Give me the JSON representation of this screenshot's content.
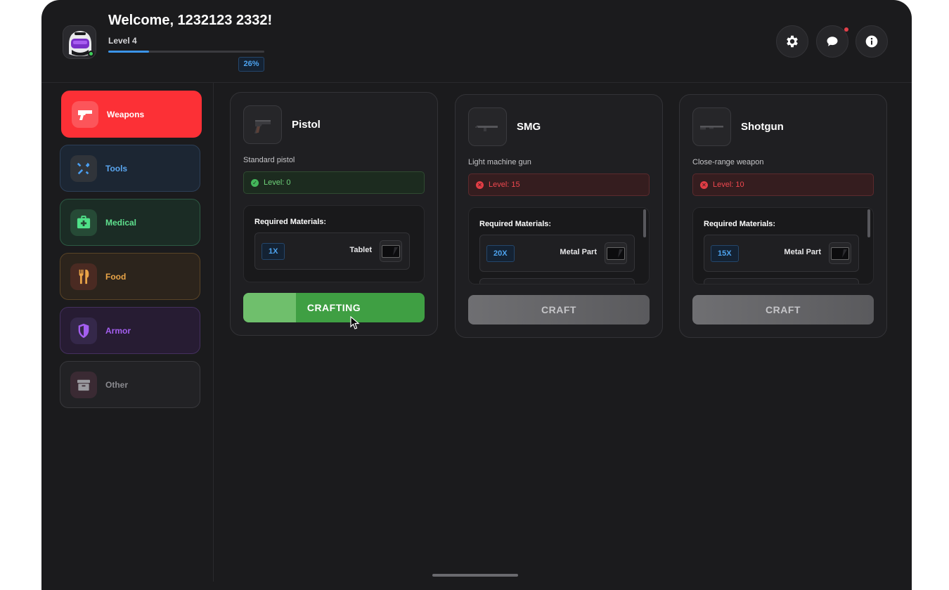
{
  "header": {
    "welcome": "Welcome, 1232123 2332!",
    "level_label": "Level 4",
    "xp_percent": "26%",
    "xp_fraction": 0.26,
    "buttons": [
      {
        "name": "settings",
        "icon": "gear-icon"
      },
      {
        "name": "messages",
        "icon": "chat-icon",
        "has_notification": true
      },
      {
        "name": "info",
        "icon": "info-icon"
      }
    ]
  },
  "sidebar": {
    "items": [
      {
        "label": "Weapons",
        "icon": "pistol-icon",
        "active": true,
        "color": "#fc3036"
      },
      {
        "label": "Tools",
        "icon": "tools-icon",
        "color": "#5aa6f0"
      },
      {
        "label": "Medical",
        "icon": "medkit-icon",
        "color": "#5fe08e"
      },
      {
        "label": "Food",
        "icon": "utensils-icon",
        "color": "#eaa548"
      },
      {
        "label": "Armor",
        "icon": "shield-icon",
        "color": "#a45ff0"
      },
      {
        "label": "Other",
        "icon": "box-icon",
        "color": "#8a8a8f"
      }
    ]
  },
  "recipes": [
    {
      "title": "Pistol",
      "description": "Standard pistol",
      "level": "Level: 0",
      "level_met": true,
      "materials_title": "Required Materials:",
      "materials": [
        {
          "qty": "1X",
          "name": "Tablet"
        }
      ],
      "button": "CRAFTING",
      "progress_fraction": 0.29
    },
    {
      "title": "SMG",
      "description": "Light machine gun",
      "level": "Level: 15",
      "level_met": false,
      "materials_title": "Required Materials:",
      "materials": [
        {
          "qty": "20X",
          "name": "Metal Part"
        }
      ],
      "button": "CRAFT"
    },
    {
      "title": "Shotgun",
      "description": "Close-range weapon",
      "level": "Level: 10",
      "level_met": false,
      "materials_title": "Required Materials:",
      "materials": [
        {
          "qty": "15X",
          "name": "Metal Part"
        }
      ],
      "button": "CRAFT"
    }
  ]
}
